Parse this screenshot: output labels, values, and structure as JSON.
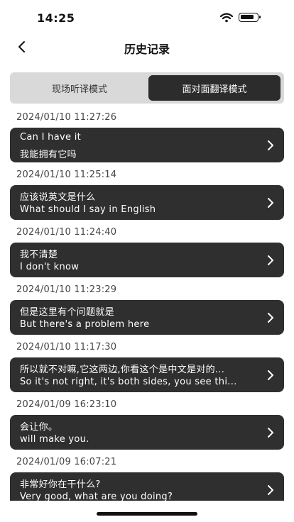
{
  "status": {
    "time": "14:25"
  },
  "nav": {
    "title": "历史记录"
  },
  "tabs": [
    {
      "label": "现场听译模式",
      "active": false
    },
    {
      "label": "面对面翻译模式",
      "active": true
    }
  ],
  "records": [
    {
      "timestamp": "2024/01/10 11:27:26",
      "line1": "Can I have it",
      "line2": "我能拥有它吗"
    },
    {
      "timestamp": "2024/01/10 11:25:14",
      "line1": "应该说英文是什么",
      "line2": "What should I say in English"
    },
    {
      "timestamp": "2024/01/10 11:24:40",
      "line1": "我不清楚",
      "line2": "I don't know"
    },
    {
      "timestamp": "2024/01/10 11:23:29",
      "line1": "但是这里有个问题就是",
      "line2": "But there's a problem here"
    },
    {
      "timestamp": "2024/01/10 11:17:30",
      "line1": "所以就不对嘛,它这两边,你看这个是中文是对的...",
      "line2": "So it's not right, it's both sides, you see thi..."
    },
    {
      "timestamp": "2024/01/09 16:23:10",
      "line1": "会让你。",
      "line2": "will make you."
    },
    {
      "timestamp": "2024/01/09 16:07:21",
      "line1": "非常好你在干什么?",
      "line2": "Very good, what are you doing?"
    }
  ],
  "colors": {
    "card": "#2f2f2f",
    "segment_active": "#2c2c2c",
    "segment_bg": "#d9d9d9"
  }
}
